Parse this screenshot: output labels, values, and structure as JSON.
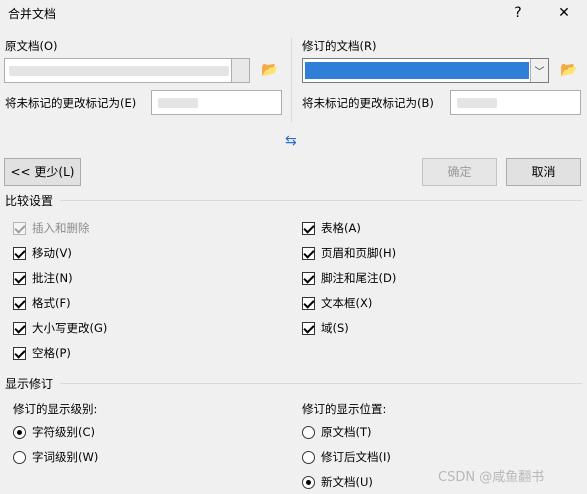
{
  "window": {
    "title": "合并文档",
    "help": "?",
    "close": "✕"
  },
  "original": {
    "label": "原文档(O)",
    "unmarked_label": "将未标记的更改标记为(E)"
  },
  "revised": {
    "label": "修订的文档(R)",
    "unmarked_label": "将未标记的更改标记为(B)"
  },
  "icons": {
    "swap": "⇆",
    "folder": "📂",
    "dropdown": "﹀"
  },
  "buttons": {
    "less": "<< 更少(L)",
    "ok": "确定",
    "cancel": "取消"
  },
  "compare": {
    "title": "比较设置",
    "left": [
      {
        "label": "插入和删除",
        "checked": true,
        "disabled": true
      },
      {
        "label": "移动(V)",
        "checked": true
      },
      {
        "label": "批注(N)",
        "checked": true
      },
      {
        "label": "格式(F)",
        "checked": true
      },
      {
        "label": "大小写更改(G)",
        "checked": true
      },
      {
        "label": "空格(P)",
        "checked": true
      }
    ],
    "right": [
      {
        "label": "表格(A)",
        "checked": true
      },
      {
        "label": "页眉和页脚(H)",
        "checked": true
      },
      {
        "label": "脚注和尾注(D)",
        "checked": true
      },
      {
        "label": "文本框(X)",
        "checked": true
      },
      {
        "label": "域(S)",
        "checked": true
      }
    ]
  },
  "show": {
    "title": "显示修订",
    "level_label": "修订的显示级别:",
    "levels": [
      {
        "label": "字符级别(C)",
        "selected": true
      },
      {
        "label": "字词级别(W)",
        "selected": false
      }
    ],
    "location_label": "修订的显示位置:",
    "locations": [
      {
        "label": "原文档(T)",
        "selected": false
      },
      {
        "label": "修订后文档(I)",
        "selected": false
      },
      {
        "label": "新文档(U)",
        "selected": true
      }
    ]
  },
  "watermark": "CSDN @咸鱼翻书",
  "colors": {
    "selection": "#2f7ed8"
  }
}
